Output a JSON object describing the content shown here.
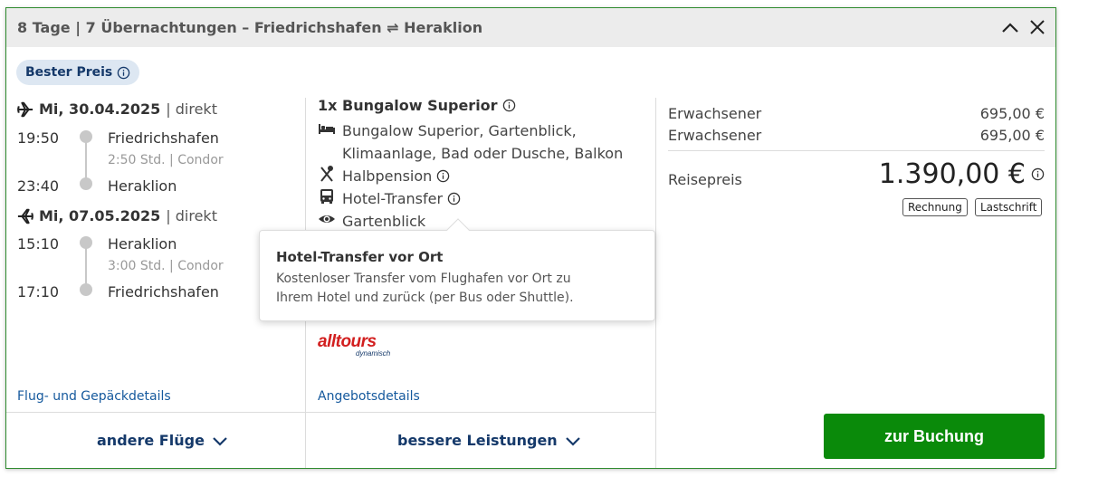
{
  "header": {
    "title": "8 Tage | 7 Übernachtungen – Friedrichshafen ⇌ Heraklion",
    "collapse_icon": "chevron-up-icon",
    "close_icon": "close-icon"
  },
  "badge": {
    "label": "Bester Preis",
    "icon": "info-icon"
  },
  "flights": {
    "outbound": {
      "date": "Mi, 30.04.2025",
      "type": "| direkt",
      "dep_time": "19:50",
      "dep_place": "Friedrichshafen",
      "duration": "2:50 Std. | Condor",
      "arr_time": "23:40",
      "arr_place": "Heraklion"
    },
    "return": {
      "date": "Mi, 07.05.2025",
      "type": "| direkt",
      "dep_time": "15:10",
      "dep_place": "Heraklion",
      "duration": "3:00 Std. | Condor",
      "arr_time": "17:10",
      "arr_place": "Friedrichshafen"
    },
    "details_link": "Flug- und Gepäckdetails",
    "more_label": "andere Flüge"
  },
  "hotel": {
    "room_title": "1x Bungalow Superior",
    "room_desc_line1": "Bungalow Superior, Gartenblick,",
    "room_desc_line2": "Klimaanlage, Bad oder Dusche, Balkon",
    "board": "Halbpension",
    "transfer": "Hotel-Transfer",
    "view": "Gartenblick",
    "logo_text": "alltours",
    "logo_sub": "dynamisch",
    "details_link": "Angebotsdetails",
    "more_label": "bessere Leistungen"
  },
  "tooltip": {
    "title": "Hotel-Transfer vor Ort",
    "line1": "Kostenloser Transfer vom Flughafen vor Ort zu",
    "line2": "Ihrem Hotel und zurück (per Bus oder Shuttle)."
  },
  "price": {
    "rows": [
      {
        "label": "Erwachsener",
        "value": "695,00 €"
      },
      {
        "label": "Erwachsener",
        "value": "695,00 €"
      }
    ],
    "total_label": "Reisepreis",
    "total_value": "1.390,00 €",
    "payment_methods": [
      "Rechnung",
      "Lastschrift"
    ],
    "book_label": "zur Buchung"
  },
  "colors": {
    "accent_green": "#0a8a0a",
    "link_blue": "#15599d",
    "badge_bg": "#dde7f2"
  }
}
